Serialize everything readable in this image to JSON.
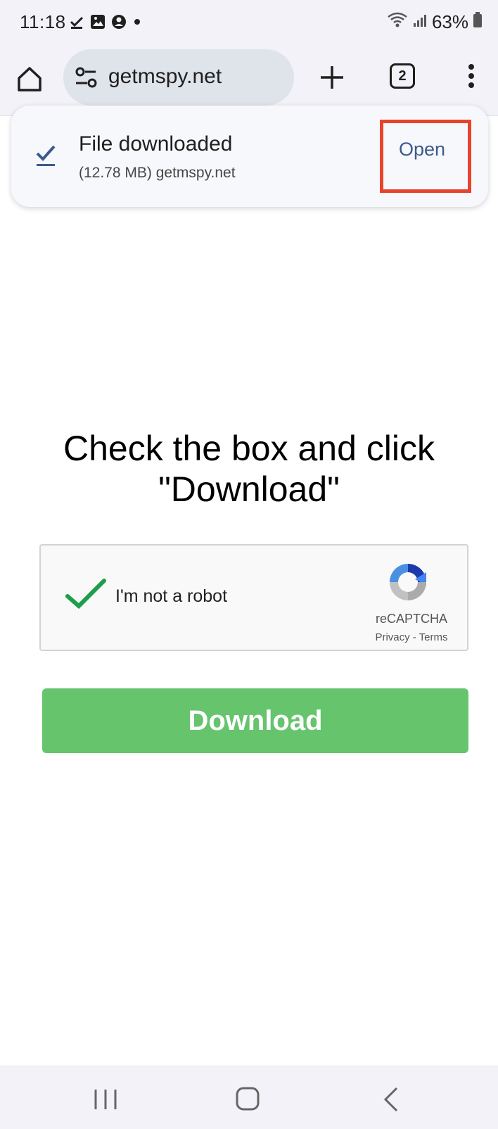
{
  "status_bar": {
    "time": "11:18",
    "battery": "63%"
  },
  "toolbar": {
    "url": "getmspy.net",
    "tab_count": "2"
  },
  "download_notice": {
    "title": "File downloaded",
    "subtitle": "(12.78 MB) getmspy.net",
    "open_label": "Open"
  },
  "page": {
    "headline_line1": "Check the box and click",
    "headline_line2": "\"Download\"",
    "captcha_label": "I'm not a robot",
    "recaptcha_name": "reCAPTCHA",
    "recaptcha_links": "Privacy - Terms",
    "download_label": "Download"
  },
  "colors": {
    "download_button": "#66c46d",
    "highlight": "#e8432c",
    "open_link": "#3c5a8c",
    "check_green": "#1e9e4d"
  }
}
